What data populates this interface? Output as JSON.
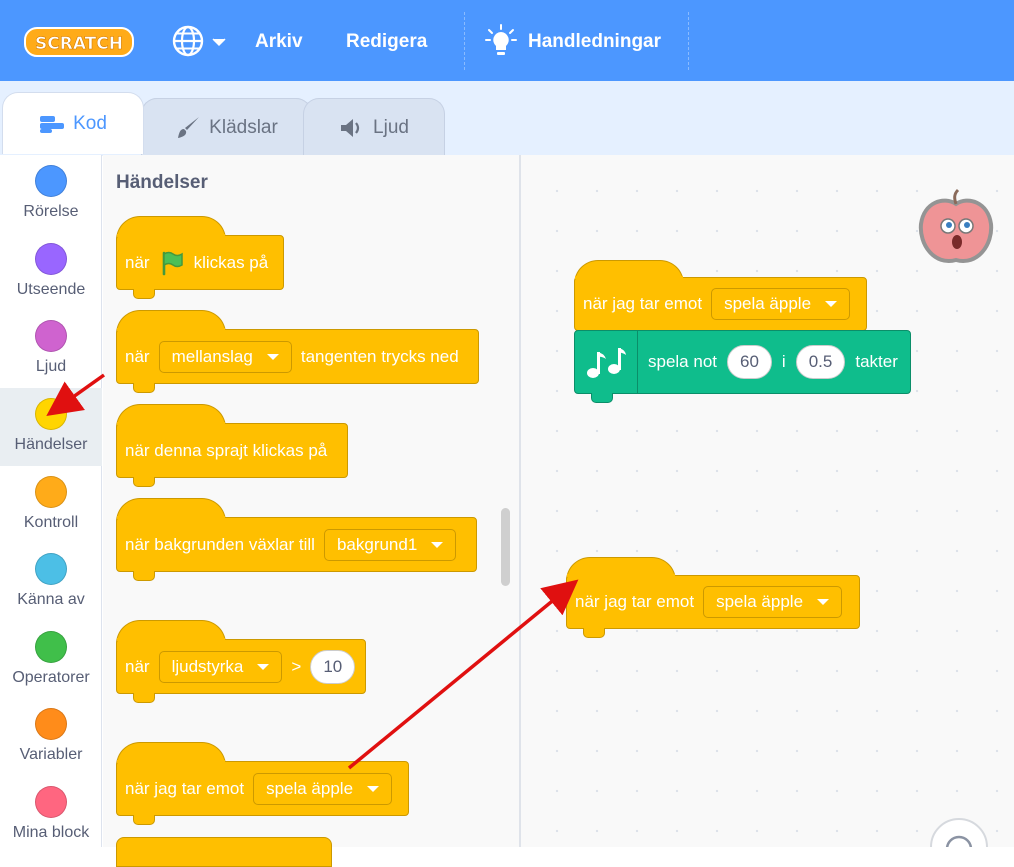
{
  "menubar": {
    "logo_text": "SCRATCH",
    "arkiv": "Arkiv",
    "redigera": "Redigera",
    "handledningar": "Handledningar"
  },
  "tabs": {
    "kod": "Kod",
    "kladslar": "Klädslar",
    "ljud": "Ljud"
  },
  "categories": [
    {
      "label": "Rörelse",
      "color": "#4c97ff"
    },
    {
      "label": "Utseende",
      "color": "#9966ff"
    },
    {
      "label": "Ljud",
      "color": "#cf63cf"
    },
    {
      "label": "Händelser",
      "color": "#ffd500"
    },
    {
      "label": "Kontroll",
      "color": "#ffab19"
    },
    {
      "label": "Känna av",
      "color": "#4cbfe6"
    },
    {
      "label": "Operatorer",
      "color": "#40bf4a"
    },
    {
      "label": "Variabler",
      "color": "#ff8c1a"
    },
    {
      "label": "Mina block",
      "color": "#ff6680"
    }
  ],
  "palette": {
    "title": "Händelser",
    "flag_block": {
      "pre": "när",
      "post": "klickas på"
    },
    "key_block": {
      "pre": "när",
      "key": "mellanslag",
      "post": "tangenten trycks ned"
    },
    "sprite_click": "när denna sprajt klickas på",
    "backdrop_block": {
      "pre": "när bakgrunden växlar till",
      "backdrop": "bakgrund1"
    },
    "loudness_block": {
      "pre": "när",
      "sensor": "ljudstyrka",
      "op": ">",
      "value": "10"
    },
    "receive_block": {
      "pre": "när jag tar emot",
      "message": "spela äpple"
    }
  },
  "workspace": {
    "script1": {
      "hat_pre": "när jag tar emot",
      "hat_msg": "spela äpple",
      "note_label": "spela not",
      "note": "60",
      "mid": "i",
      "beats": "0.5",
      "post": "takter"
    },
    "script2": {
      "hat_pre": "när jag tar emot",
      "hat_msg": "spela äpple"
    }
  },
  "colors": {
    "menubar": "#4c97ff",
    "events": "#ffbf00",
    "music": "#0fbd8c",
    "annotation": "#e01010"
  }
}
